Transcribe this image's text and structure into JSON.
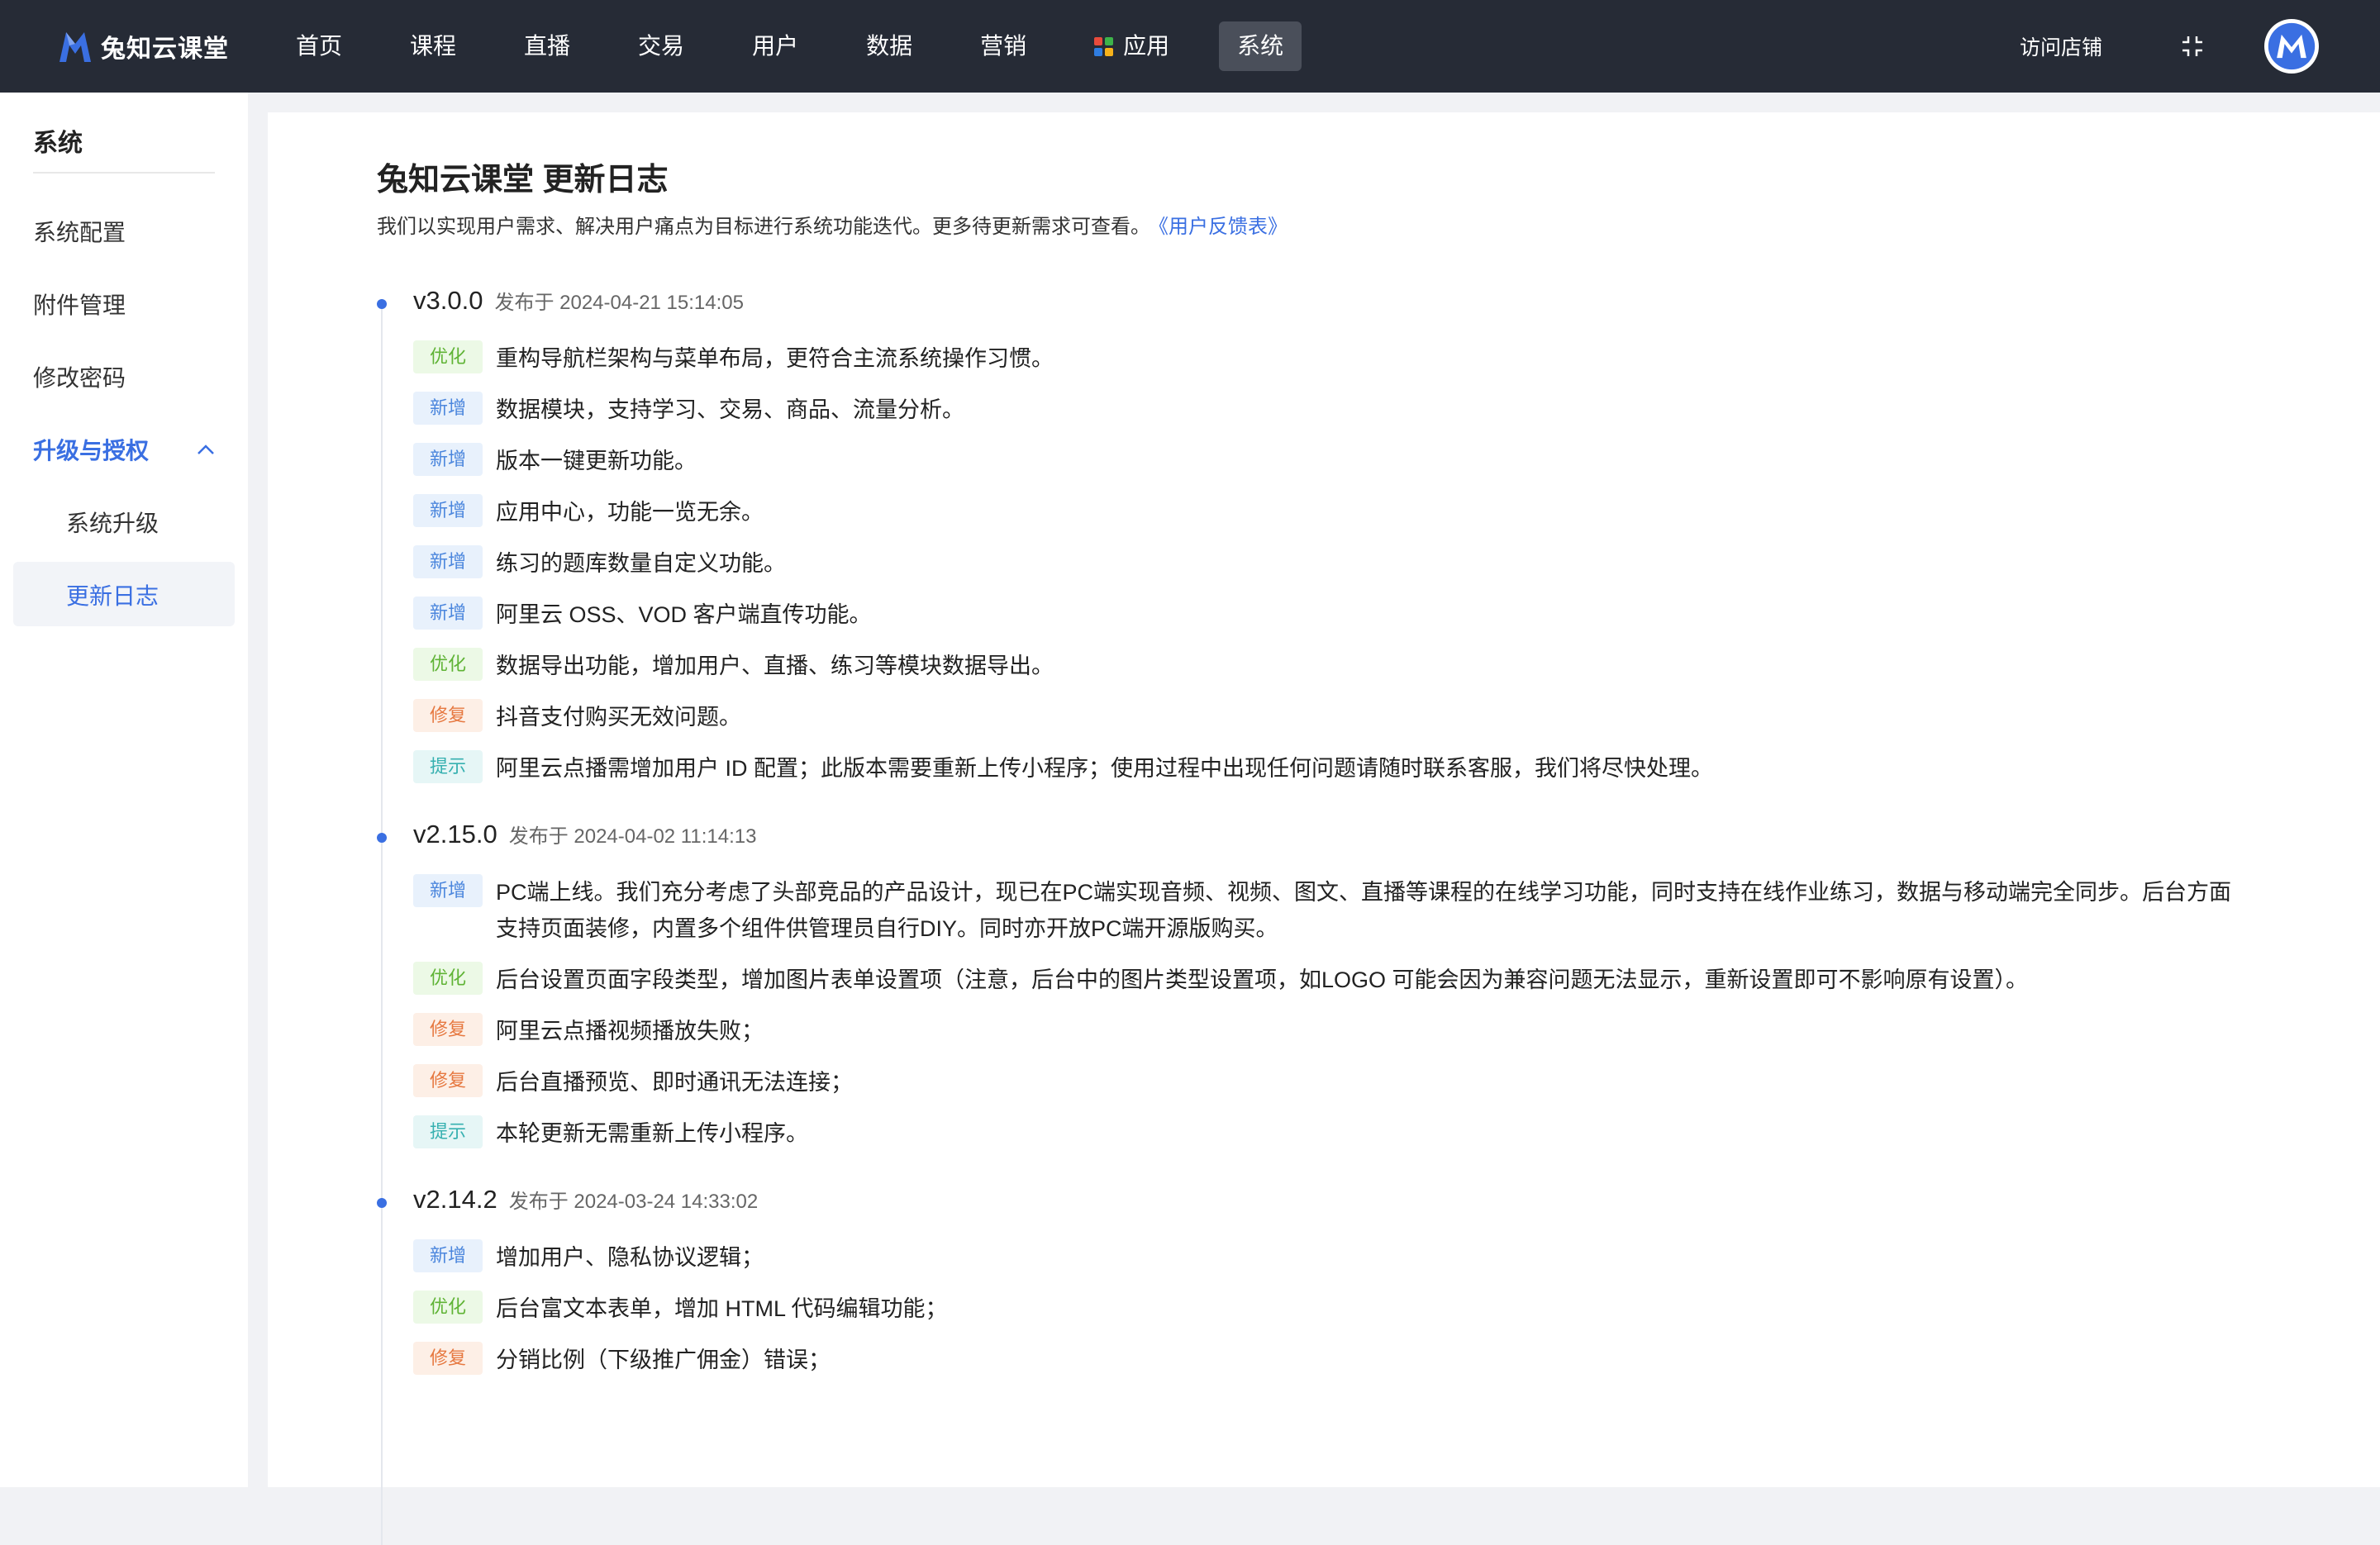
{
  "header": {
    "brand": "兔知云课堂",
    "nav": [
      "首页",
      "课程",
      "直播",
      "交易",
      "用户",
      "数据",
      "营销",
      "应用",
      "系统"
    ],
    "active_nav": "系统",
    "visit_store": "访问店铺",
    "apps_icon_colors": [
      "#e94b3c",
      "#3db34a",
      "#2f7de1",
      "#f6b21b"
    ]
  },
  "sidebar": {
    "title": "系统",
    "items": [
      "系统配置",
      "附件管理",
      "修改密码"
    ],
    "group": "升级与授权",
    "sub_items": [
      "系统升级",
      "更新日志"
    ],
    "active_sub": "更新日志"
  },
  "main": {
    "title": "兔知云课堂 更新日志",
    "description": "我们以实现用户需求、解决用户痛点为目标进行系统功能迭代。更多待更新需求可查看。",
    "feedback_link": "《用户反馈表》",
    "releases": [
      {
        "version": "v3.0.0",
        "date": "发布于 2024-04-21 15:14:05",
        "items": [
          {
            "tag": "优化",
            "type": "opt",
            "text": "重构导航栏架构与菜单布局，更符合主流系统操作习惯。"
          },
          {
            "tag": "新增",
            "type": "new",
            "text": "数据模块，支持学习、交易、商品、流量分析。"
          },
          {
            "tag": "新增",
            "type": "new",
            "text": "版本一键更新功能。"
          },
          {
            "tag": "新增",
            "type": "new",
            "text": "应用中心，功能一览无余。"
          },
          {
            "tag": "新增",
            "type": "new",
            "text": "练习的题库数量自定义功能。"
          },
          {
            "tag": "新增",
            "type": "new",
            "text": "阿里云 OSS、VOD 客户端直传功能。"
          },
          {
            "tag": "优化",
            "type": "opt",
            "text": "数据导出功能，增加用户、直播、练习等模块数据导出。"
          },
          {
            "tag": "修复",
            "type": "fix",
            "text": "抖音支付购买无效问题。"
          },
          {
            "tag": "提示",
            "type": "tip",
            "text": "阿里云点播需增加用户 ID 配置；此版本需要重新上传小程序；使用过程中出现任何问题请随时联系客服，我们将尽快处理。"
          }
        ]
      },
      {
        "version": "v2.15.0",
        "date": "发布于 2024-04-02 11:14:13",
        "items": [
          {
            "tag": "新增",
            "type": "new",
            "text": "PC端上线。我们充分考虑了头部竞品的产品设计，现已在PC端实现音频、视频、图文、直播等课程的在线学习功能，同时支持在线作业练习，数据与移动端完全同步。后台方面支持页面装修，内置多个组件供管理员自行DIY。同时亦开放PC端开源版购买。"
          },
          {
            "tag": "优化",
            "type": "opt",
            "text": "后台设置页面字段类型，增加图片表单设置项（注意，后台中的图片类型设置项，如LOGO 可能会因为兼容问题无法显示，重新设置即可不影响原有设置）。"
          },
          {
            "tag": "修复",
            "type": "fix",
            "text": "阿里云点播视频播放失败；"
          },
          {
            "tag": "修复",
            "type": "fix",
            "text": "后台直播预览、即时通讯无法连接；"
          },
          {
            "tag": "提示",
            "type": "tip",
            "text": "本轮更新无需重新上传小程序。"
          }
        ]
      },
      {
        "version": "v2.14.2",
        "date": "发布于 2024-03-24 14:33:02",
        "items": [
          {
            "tag": "新增",
            "type": "new",
            "text": "增加用户、隐私协议逻辑；"
          },
          {
            "tag": "优化",
            "type": "opt",
            "text": "后台富文本表单，增加 HTML 代码编辑功能；"
          },
          {
            "tag": "修复",
            "type": "fix",
            "text": "分销比例（下级推广佣金）错误；"
          }
        ]
      }
    ]
  }
}
